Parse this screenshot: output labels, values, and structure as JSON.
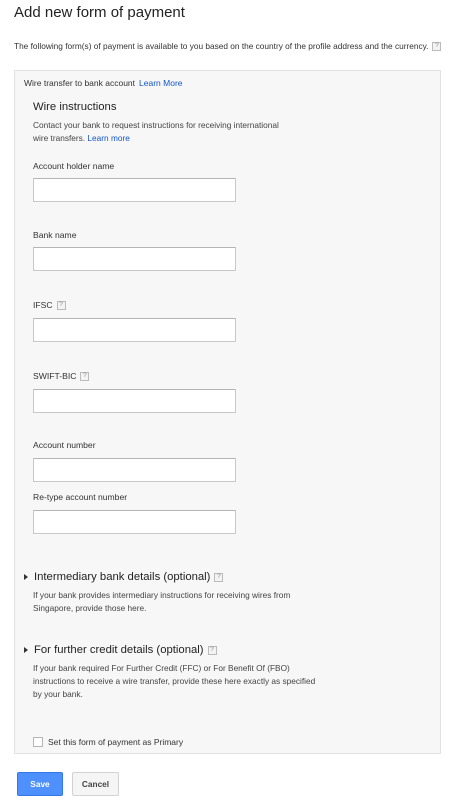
{
  "page": {
    "title": "Add new form of payment",
    "intro": "The following form(s) of payment is available to you based on the country of the profile address and the currency.",
    "help_glyph": "?"
  },
  "panel": {
    "method": "Wire transfer to bank account",
    "method_link": "Learn More",
    "wire_instructions": {
      "title": "Wire instructions",
      "description_line1": "Contact your bank to request instructions for receiving international",
      "description_line2": "wire transfers.",
      "link": "Learn more"
    },
    "fields": {
      "account_holder_name": {
        "label": "Account holder name",
        "value": ""
      },
      "bank_name": {
        "label": "Bank name",
        "value": ""
      },
      "ifsc": {
        "label": "IFSC",
        "value": ""
      },
      "swift_bic": {
        "label": "SWIFT-BIC",
        "value": ""
      },
      "account_number": {
        "label": "Account number",
        "value": ""
      },
      "retype_account_number": {
        "label": "Re-type account number",
        "value": ""
      }
    },
    "intermediary": {
      "title": "Intermediary bank details (optional)",
      "description": "If your bank provides intermediary instructions for receiving wires from Singapore, provide those here."
    },
    "further_credit": {
      "title": "For further credit details (optional)",
      "description": "If your bank required For Further Credit (FFC) or For Benefit Of (FBO) instructions to receive a wire transfer, provide these here exactly as specified by your bank."
    },
    "primary_checkbox": {
      "label": "Set this form of payment as Primary",
      "checked": false
    }
  },
  "buttons": {
    "save": "Save",
    "cancel": "Cancel"
  },
  "colors": {
    "link": "#1155cc",
    "primary_button": "#4d90fe",
    "panel_bg": "#f7f7f7"
  },
  "icons": {
    "help": "help-icon",
    "expand": "expand-arrow-icon"
  }
}
